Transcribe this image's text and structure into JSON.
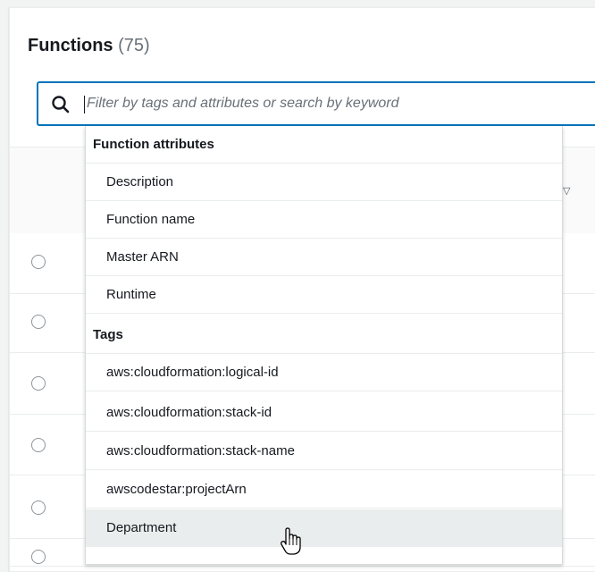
{
  "header": {
    "title": "Functions",
    "count": "(75)"
  },
  "search": {
    "placeholder": "Filter by tags and attributes or search by keyword",
    "value": ""
  },
  "icons": {
    "search": "search-icon",
    "sort": "sort-descending-icon",
    "cursor": "hand-pointer-cursor"
  },
  "dropdown": {
    "groups": [
      {
        "label": "Function attributes",
        "options": [
          "Description",
          "Function name",
          "Master ARN",
          "Runtime"
        ]
      },
      {
        "label": "Tags",
        "options": [
          "aws:cloudformation:logical-id",
          "aws:cloudformation:stack-id",
          "aws:cloudformation:stack-name",
          "awscodestar:projectArn",
          "Department"
        ]
      }
    ],
    "hovered_option": "Department"
  },
  "colors": {
    "accent": "#0073bb",
    "hover": "#eaeded",
    "text": "#16191f",
    "muted": "#687078"
  }
}
